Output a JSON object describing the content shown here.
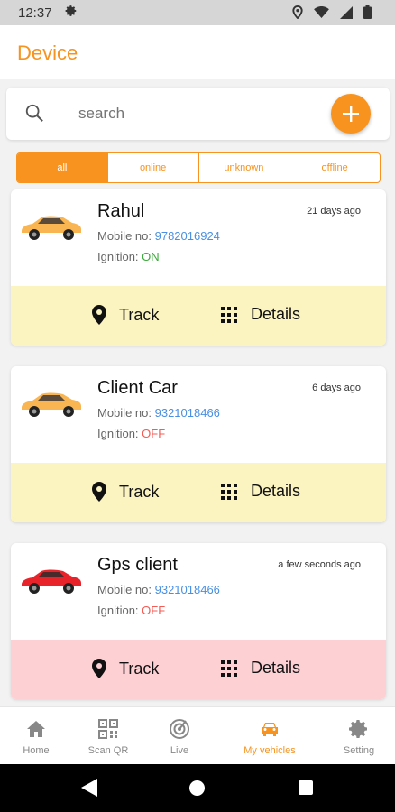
{
  "status_bar": {
    "time": "12:37"
  },
  "app_bar": {
    "title": "Device"
  },
  "search": {
    "placeholder": "search"
  },
  "filters": [
    {
      "label": "all",
      "active": true
    },
    {
      "label": "online",
      "active": false
    },
    {
      "label": "unknown",
      "active": false
    },
    {
      "label": "offline",
      "active": false
    }
  ],
  "devices": [
    {
      "name": "Rahul",
      "ago": "21 days ago",
      "mobile_label": "Mobile no:",
      "mobile": "9782016924",
      "ignition_label": "Ignition:",
      "ignition": "ON",
      "car_color": "#f9b552",
      "action_bg": "#fbf3c0",
      "track_label": "Track",
      "details_label": "Details"
    },
    {
      "name": "Client Car",
      "ago": "6 days ago",
      "mobile_label": "Mobile no:",
      "mobile": "9321018466",
      "ignition_label": "Ignition:",
      "ignition": "OFF",
      "car_color": "#f9b552",
      "action_bg": "#fbf3c0",
      "track_label": "Track",
      "details_label": "Details"
    },
    {
      "name": "Gps client",
      "ago": "a few seconds ago",
      "mobile_label": "Mobile no:",
      "mobile": "9321018466",
      "ignition_label": "Ignition:",
      "ignition": "OFF",
      "car_color": "#e8232a",
      "action_bg": "#fdd0d4",
      "track_label": "Track",
      "details_label": "Details"
    }
  ],
  "bottom_nav": [
    {
      "label": "Home",
      "icon": "home-icon",
      "active": false
    },
    {
      "label": "Scan QR",
      "icon": "qr-icon",
      "active": false
    },
    {
      "label": "Live",
      "icon": "radar-icon",
      "active": false
    },
    {
      "label": "My vehicles",
      "icon": "car-icon",
      "active": true
    },
    {
      "label": "Setting",
      "icon": "gear-icon",
      "active": false
    }
  ],
  "colors": {
    "accent": "#f7931e",
    "ignition_on": "#3caa3c",
    "ignition_off": "#f25c54",
    "link": "#4a90e2"
  }
}
